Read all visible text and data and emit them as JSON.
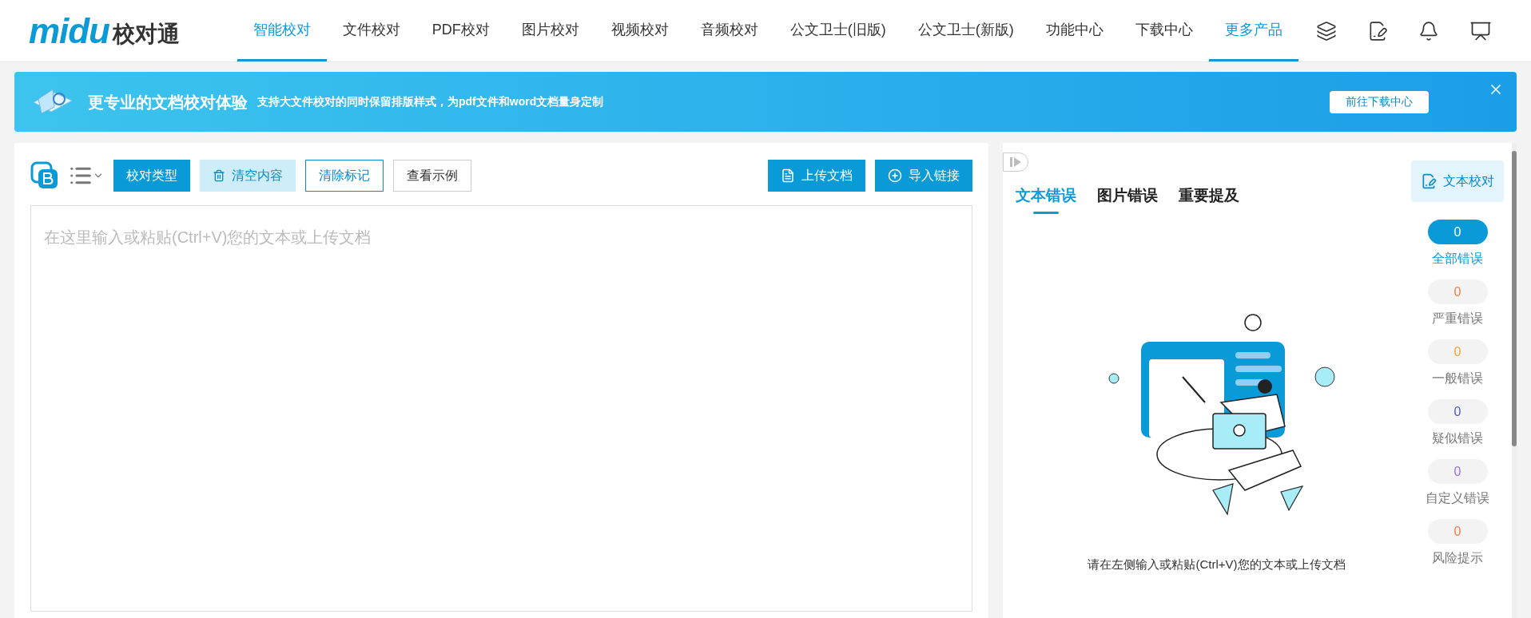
{
  "logo": {
    "latin": "midu",
    "cjk": "校对通"
  },
  "nav": [
    {
      "label": "智能校对",
      "selected": true
    },
    {
      "label": "文件校对",
      "selected": false
    },
    {
      "label": "PDF校对",
      "selected": false
    },
    {
      "label": "图片校对",
      "selected": false
    },
    {
      "label": "视频校对",
      "selected": false
    },
    {
      "label": "音频校对",
      "selected": false
    },
    {
      "label": "公文卫士(旧版)",
      "selected": false
    },
    {
      "label": "公文卫士(新版)",
      "selected": false
    },
    {
      "label": "功能中心",
      "selected": false
    },
    {
      "label": "下载中心",
      "selected": false
    },
    {
      "label": "更多产品",
      "selected": true
    }
  ],
  "banner": {
    "title": "更专业的文档校对体验",
    "subtitle": "支持大文件校对的同时保留排版样式，为pdf文件和word文档量身定制",
    "button": "前往下载中心"
  },
  "toolbar": {
    "buttons": [
      {
        "label": "校对类型",
        "kind": "primary"
      },
      {
        "label": "清空内容",
        "kind": "light"
      },
      {
        "label": "清除标记",
        "kind": "outline"
      },
      {
        "label": "查看示例",
        "kind": "plain"
      }
    ],
    "right_buttons": [
      {
        "label": "上传文档",
        "kind": "upload"
      },
      {
        "label": "导入链接",
        "kind": "link"
      }
    ]
  },
  "editor": {
    "placeholder": "在这里输入或粘贴(Ctrl+V)您的文本或上传文档"
  },
  "result_tabs": [
    {
      "label": "文本错误",
      "selected": true
    },
    {
      "label": "图片错误",
      "selected": false
    },
    {
      "label": "重要提及",
      "selected": false
    }
  ],
  "empty_message": "请在左侧输入或粘贴(Ctrl+V)您的文本或上传文档",
  "side_button": "文本校对",
  "counts": [
    {
      "count": "0",
      "label": "全部错误",
      "selected": true
    },
    {
      "count": "0",
      "label": "严重错误",
      "selected": false,
      "color": "#ef7d4a"
    },
    {
      "count": "0",
      "label": "一般错误",
      "selected": false,
      "color": "#f0a43a"
    },
    {
      "count": "0",
      "label": "疑似错误",
      "selected": false,
      "color": "#4a5cc8"
    },
    {
      "count": "0",
      "label": "自定义错误",
      "selected": false,
      "color": "#9b74e0"
    },
    {
      "count": "0",
      "label": "风险提示",
      "selected": false,
      "color": "#ef7d4a"
    }
  ]
}
